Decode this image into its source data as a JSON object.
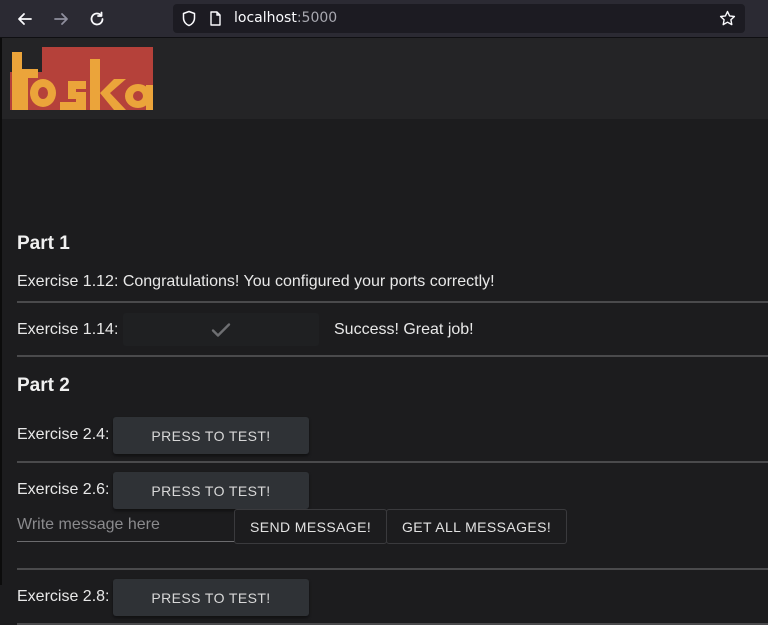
{
  "browser": {
    "url_host": "localhost",
    "url_port": ":5000"
  },
  "logo": {
    "text": "toska"
  },
  "part1": {
    "heading": "Part 1",
    "ex112": "Exercise 1.12: Congratulations! You configured your ports correctly!",
    "ex114_label": "Exercise 1.14:",
    "ex114_status": "Success! Great job!"
  },
  "part2": {
    "heading": "Part 2",
    "ex24_label": "Exercise 2.4:",
    "ex26_label": "Exercise 2.6:",
    "ex28_label": "Exercise 2.8:",
    "test_button": "PRESS TO TEST!",
    "message_placeholder": "Write message here",
    "send_button": "SEND MESSAGE!",
    "get_all_button": "GET ALL MESSAGES!"
  }
}
